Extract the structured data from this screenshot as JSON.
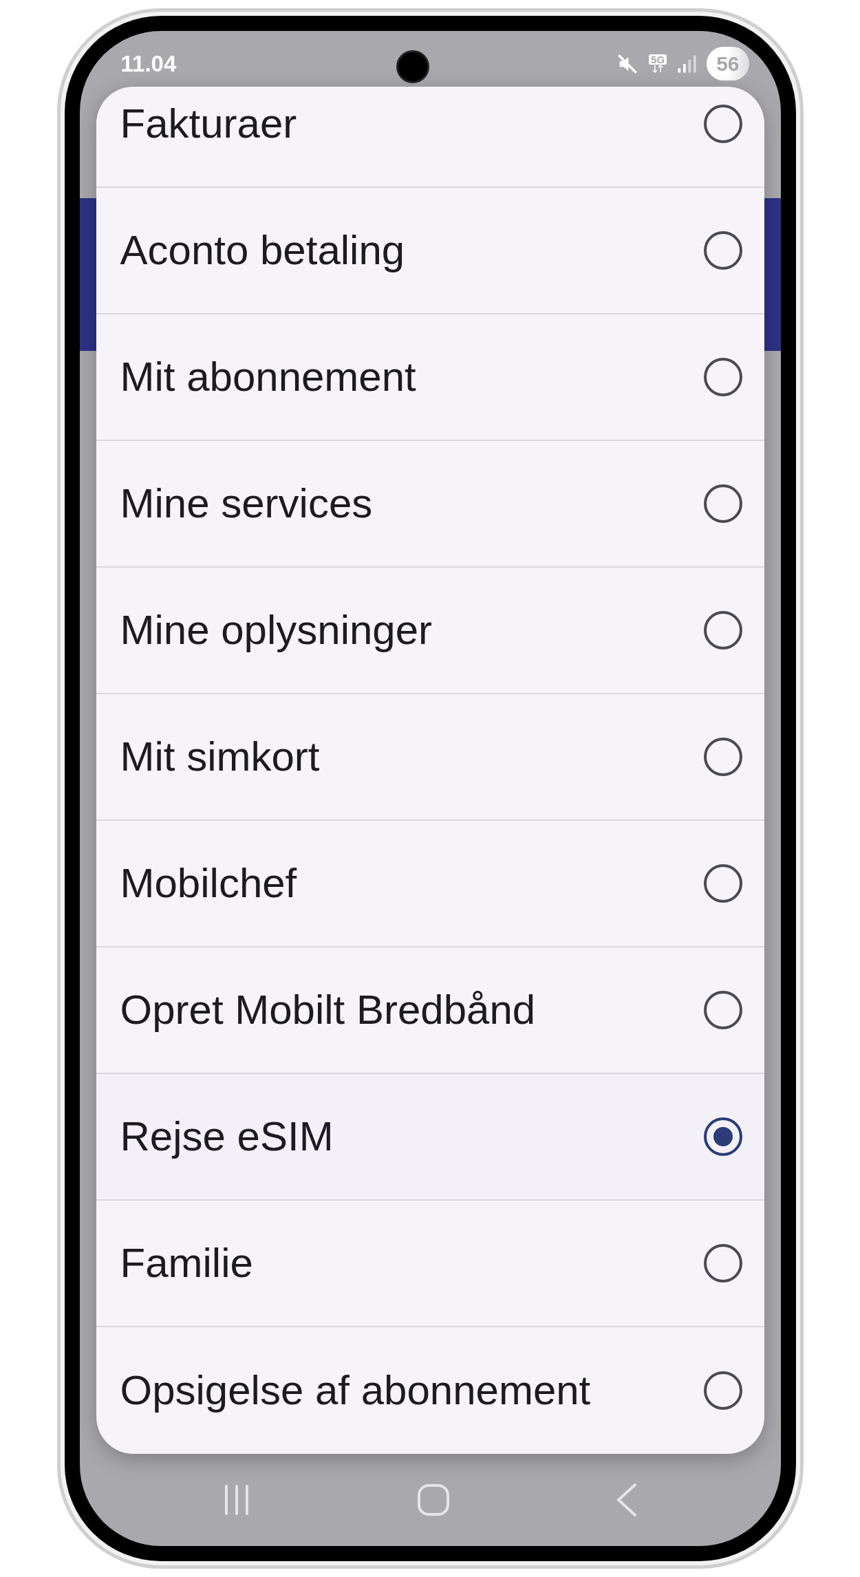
{
  "status_bar": {
    "time": "11.04",
    "network": "5G",
    "battery": "56"
  },
  "dialog": {
    "options": [
      {
        "label": "Fakturaer",
        "selected": false
      },
      {
        "label": "Aconto betaling",
        "selected": false
      },
      {
        "label": "Mit abonnement",
        "selected": false
      },
      {
        "label": "Mine services",
        "selected": false
      },
      {
        "label": "Mine oplysninger",
        "selected": false
      },
      {
        "label": "Mit simkort",
        "selected": false
      },
      {
        "label": "Mobilchef",
        "selected": false
      },
      {
        "label": "Opret Mobilt Bredbånd",
        "selected": false
      },
      {
        "label": "Rejse eSIM",
        "selected": true
      },
      {
        "label": "Familie",
        "selected": false
      },
      {
        "label": "Opsigelse af abonnement",
        "selected": false
      }
    ]
  }
}
